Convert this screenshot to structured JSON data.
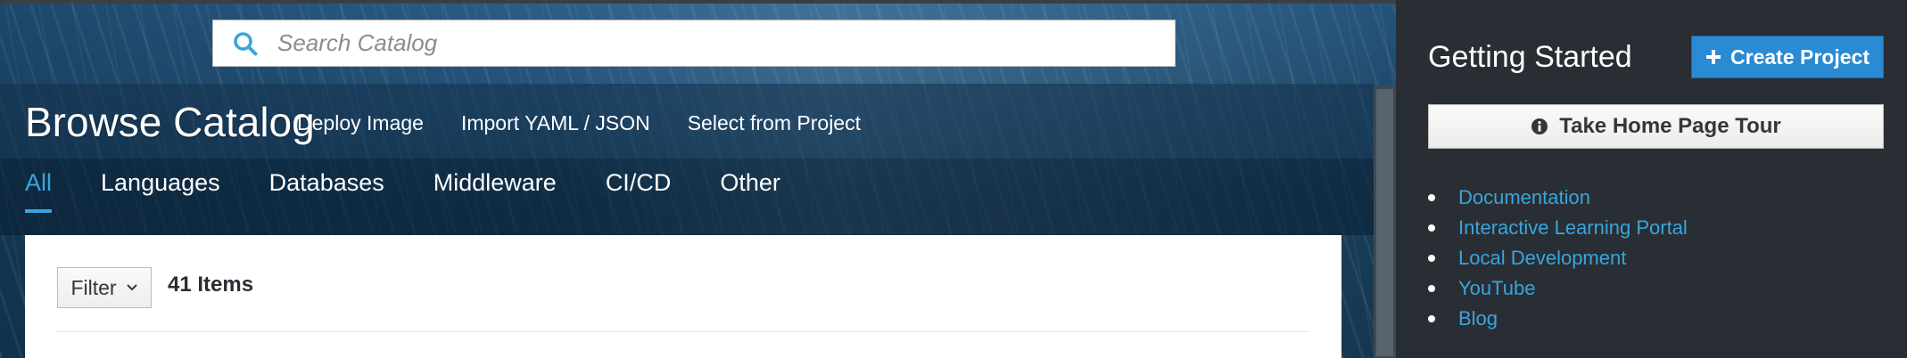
{
  "search": {
    "placeholder": "Search Catalog",
    "icon": "search-icon"
  },
  "header": {
    "title": "Browse Catalog",
    "actions": [
      {
        "label": "Deploy Image"
      },
      {
        "label": "Import YAML / JSON"
      },
      {
        "label": "Select from Project"
      }
    ]
  },
  "tabs": [
    {
      "label": "All",
      "active": true
    },
    {
      "label": "Languages",
      "active": false
    },
    {
      "label": "Databases",
      "active": false
    },
    {
      "label": "Middleware",
      "active": false
    },
    {
      "label": "CI/CD",
      "active": false
    },
    {
      "label": "Other",
      "active": false
    }
  ],
  "catalog": {
    "filter_label": "Filter",
    "items_count": "41 Items"
  },
  "side_panel": {
    "title": "Getting Started",
    "create_project_label": "Create Project",
    "tour_label": "Take Home Page Tour",
    "links": [
      {
        "label": "Documentation"
      },
      {
        "label": "Interactive Learning Portal"
      },
      {
        "label": "Local Development"
      },
      {
        "label": "YouTube"
      },
      {
        "label": "Blog"
      }
    ]
  },
  "colors": {
    "accent": "#39a5dc",
    "primary_button": "#2a8ad4",
    "side_panel_bg": "#292e34"
  }
}
